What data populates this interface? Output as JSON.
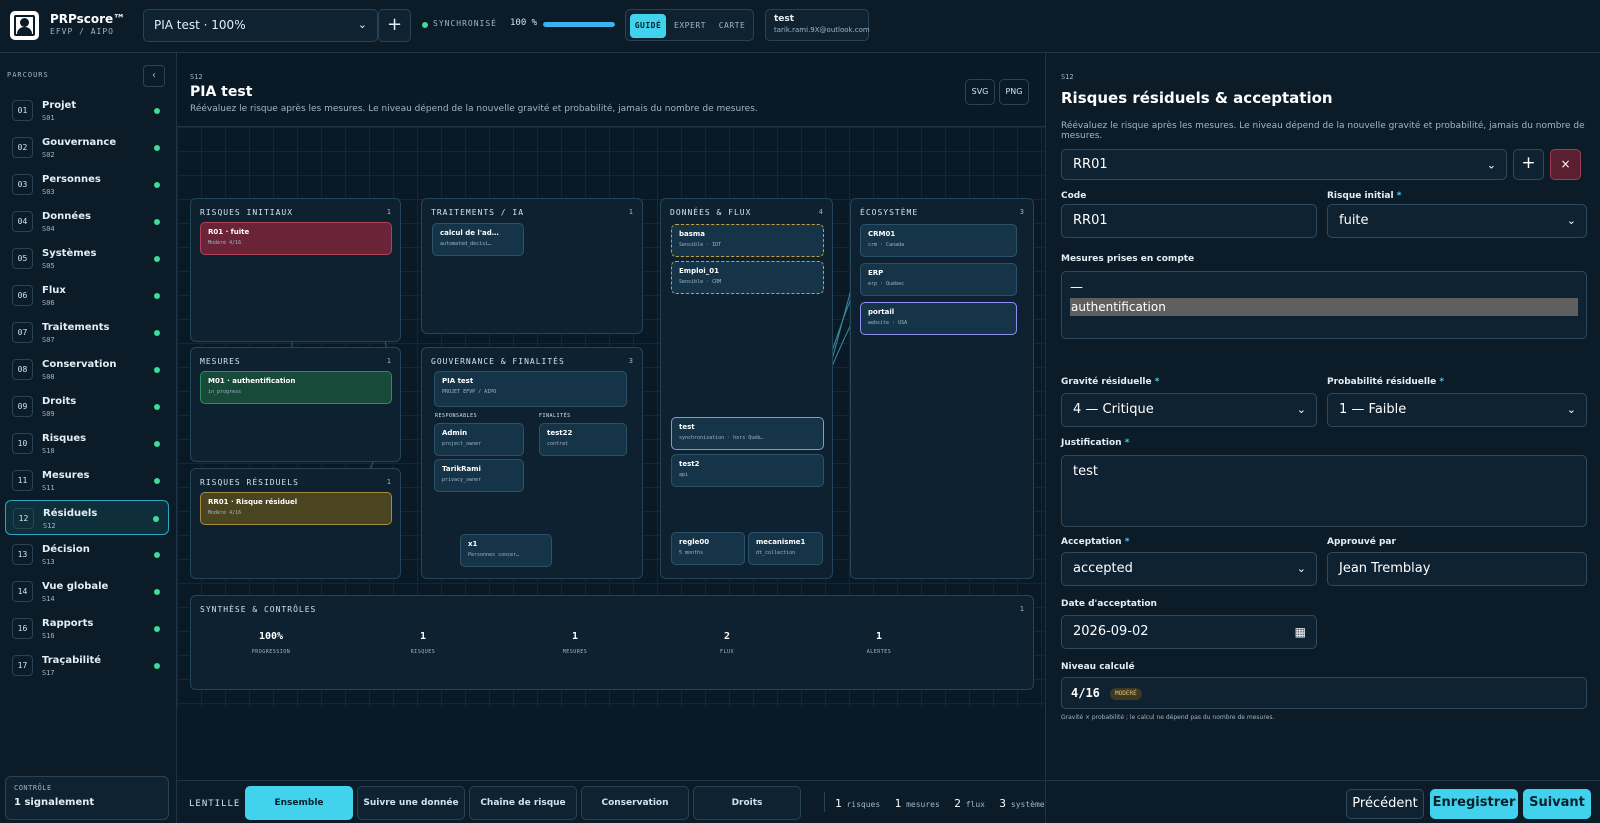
{
  "header": {
    "brand": "PRPscore™",
    "brand_sub": "EFVP / AIPO",
    "project": "PIA test · 100%",
    "add_symbol": "+",
    "sync": "SYNCHRONISÉ",
    "progress": "100 %",
    "progress_value": 100,
    "modes": [
      "GUIDÉ",
      "EXPERT",
      "CARTE"
    ],
    "user_name": "test",
    "user_email": "tarik.rami.9X@outlook.com"
  },
  "sidebar": {
    "title": "PARCOURS",
    "collapse": "‹",
    "items": [
      {
        "num": "01",
        "title": "Projet",
        "code": "S01"
      },
      {
        "num": "02",
        "title": "Gouvernance",
        "code": "S02"
      },
      {
        "num": "03",
        "title": "Personnes",
        "code": "S03"
      },
      {
        "num": "04",
        "title": "Données",
        "code": "S04"
      },
      {
        "num": "05",
        "title": "Systèmes",
        "code": "S05"
      },
      {
        "num": "06",
        "title": "Flux",
        "code": "S06"
      },
      {
        "num": "07",
        "title": "Traitements",
        "code": "S07"
      },
      {
        "num": "08",
        "title": "Conservation",
        "code": "S08"
      },
      {
        "num": "09",
        "title": "Droits",
        "code": "S09"
      },
      {
        "num": "10",
        "title": "Risques",
        "code": "S10"
      },
      {
        "num": "11",
        "title": "Mesures",
        "code": "S11"
      },
      {
        "num": "12",
        "title": "Résiduels",
        "code": "S12"
      },
      {
        "num": "13",
        "title": "Décision",
        "code": "S13"
      },
      {
        "num": "14",
        "title": "Vue globale",
        "code": "S14"
      },
      {
        "num": "16",
        "title": "Rapports",
        "code": "S16"
      },
      {
        "num": "17",
        "title": "Traçabilité",
        "code": "S17"
      }
    ],
    "control_label": "CONTRÔLE",
    "control_value": "1 signalement"
  },
  "canvas": {
    "code": "S12",
    "title": "PIA test",
    "desc": "Réévaluez le risque après les mesures. Le niveau dépend de la nouvelle gravité et probabilité, jamais du nombre de mesures.",
    "svg": "SVG",
    "png": "PNG",
    "panels": {
      "risques_initiaux": {
        "title": "RISQUES INITIAUX",
        "count": "1",
        "node_t": "R01 · fuite",
        "node_s": "Modéré 4/16"
      },
      "traitements": {
        "title": "TRAITEMENTS / IA",
        "count": "1",
        "node_t": "calcul de l'ad…",
        "node_s": "automated_decisi…"
      },
      "donnees": {
        "title": "DONNÉES & FLUX",
        "count": "4",
        "n1_t": "basma",
        "n1_s": "Sensible · IDT",
        "n2_t": "Emploi_01",
        "n2_s": "Sensible · CRM",
        "n3_t": "test",
        "n3_s": "synchronization · hors Québ…",
        "n4_t": "test2",
        "n4_s": "api",
        "n5_t": "regle00",
        "n5_s": "5 months",
        "n6_t": "mecanisme1",
        "n6_s": "dt_collection"
      },
      "ecosysteme": {
        "title": "ÉCOSYSTÈME",
        "count": "3",
        "n1_t": "CRM01",
        "n1_s": "crm · Canada",
        "n2_t": "ERP",
        "n2_s": "erp · Québec",
        "n3_t": "portail",
        "n3_s": "website · USA"
      },
      "mesures": {
        "title": "MESURES",
        "count": "1",
        "node_t": "M01 · authentification",
        "node_s": "in_progress"
      },
      "gouvernance": {
        "title": "GOUVERNANCE & FINALITÉS",
        "count": "3",
        "pia_t": "PIA test",
        "pia_s": "PROJET EFVP / AIPO",
        "resp_lbl": "RESPONSABLES",
        "fin_lbl": "FINALITÉS",
        "a1_t": "Admin",
        "a1_s": "project_owner",
        "a2_t": "TarikRami",
        "a2_s": "privacy_owner",
        "f1_t": "test22",
        "f1_s": "contrat",
        "x_t": "x1",
        "x_s": "Personnes concer…"
      },
      "residuels": {
        "title": "RISQUES RÉSIDUELS",
        "count": "1",
        "node_t": "RR01 · Risque résiduel",
        "node_s": "Modéré 4/16"
      },
      "synthese": {
        "title": "SYNTHÈSE & CONTRÔLES",
        "count": "1",
        "stats": [
          {
            "v": "100%",
            "l": "PROGRESSION"
          },
          {
            "v": "1",
            "l": "RISQUES"
          },
          {
            "v": "1",
            "l": "MESURES"
          },
          {
            "v": "2",
            "l": "FLUX"
          },
          {
            "v": "1",
            "l": "ALERTES"
          }
        ]
      }
    }
  },
  "lens": {
    "label": "LENTILLE",
    "buttons": [
      "Ensemble",
      "Suivre une donnée",
      "Chaîne de risque",
      "Conservation",
      "Droits"
    ],
    "counts": [
      {
        "n": "1",
        "l": "risques"
      },
      {
        "n": "1",
        "l": "mesures"
      },
      {
        "n": "2",
        "l": "flux"
      },
      {
        "n": "3",
        "l": "systèmes"
      }
    ]
  },
  "form": {
    "code": "S12",
    "title": "Risques résiduels & acceptation",
    "desc": "Réévaluez le risque après les mesures. Le niveau dépend de la nouvelle gravité et probabilité, jamais du nombre de mesures.",
    "record": "RR01",
    "add": "+",
    "delete": "×",
    "code_label": "Code",
    "code_value": "RR01",
    "initial_label": "Risque initial",
    "initial_value": "fuite",
    "measures_label": "Mesures prises en compte",
    "measures_options": [
      "—",
      "authentification"
    ],
    "gravity_label": "Gravité résiduelle",
    "gravity_value": "4 — Critique",
    "prob_label": "Probabilité résiduelle",
    "prob_value": "1 — Faible",
    "just_label": "Justification",
    "just_value": "test",
    "accept_label": "Acceptation",
    "accept_value": "accepted",
    "approved_label": "Approuvé par",
    "approved_value": "Jean Tremblay",
    "date_label": "Date d'acceptation",
    "date_value": "2026-09-02",
    "level_label": "Niveau calculé",
    "level_value": "4/16",
    "level_badge": "MODÉRÉ",
    "level_note": "Gravité × probabilité ; le calcul ne dépend pas du nombre de mesures.",
    "req": "*"
  },
  "footer": {
    "prev": "Précédent",
    "save": "Enregistrer",
    "next": "Suivant"
  },
  "colors": {
    "accent": "#41d3ee",
    "ok": "#3ddc97",
    "danger": "#6b2437"
  }
}
